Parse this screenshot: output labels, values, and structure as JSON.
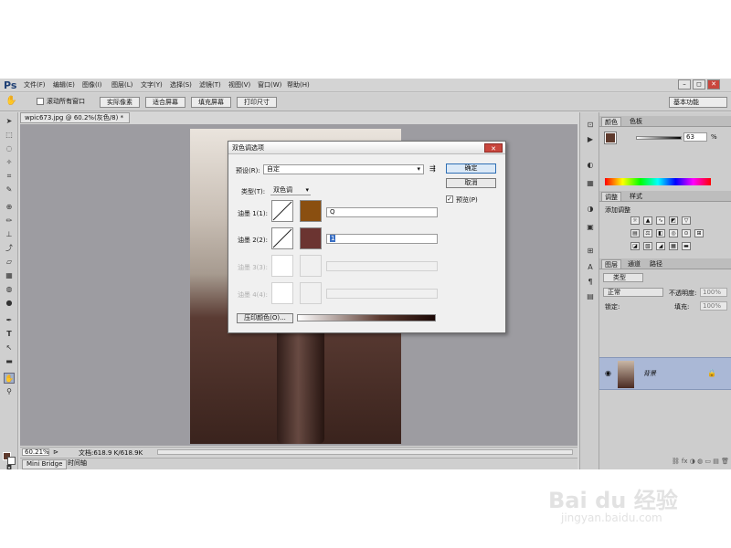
{
  "app": {
    "logo": "Ps"
  },
  "menu": [
    "文件(F)",
    "编辑(E)",
    "图像(I)",
    "图层(L)",
    "文字(Y)",
    "选择(S)",
    "滤镜(T)",
    "视图(V)",
    "窗口(W)",
    "帮助(H)"
  ],
  "window_controls": [
    "–",
    "◻",
    "✕"
  ],
  "options": {
    "scroll_all": "滚动所有窗口",
    "buttons": [
      "实际像素",
      "适合屏幕",
      "填充屏幕",
      "打印尺寸"
    ],
    "workspace": "基本功能"
  },
  "document": {
    "tab": "wpic673.jpg @ 60.2%(灰色/8) *",
    "zoom": "60.21%",
    "doc_info": "文档:618.9 K/618.9K"
  },
  "bottom_tabs": [
    "Mini Bridge",
    "时间轴"
  ],
  "panels": {
    "color_tabs": [
      "颜色",
      "色板"
    ],
    "color_value": "63",
    "color_unit": "%",
    "adjust_tabs": [
      "调整",
      "样式"
    ],
    "adjust_hint": "添加调整",
    "layers_tabs": [
      "图层",
      "通道",
      "路径"
    ],
    "kind_filter": "类型",
    "blend_mode": "正常",
    "opacity_label": "不透明度:",
    "opacity_value": "100%",
    "lock_label": "锁定:",
    "fill_label": "填充:",
    "fill_value": "100%",
    "layer_name": "背景"
  },
  "dialog": {
    "title": "双色调选项",
    "close": "✕",
    "preset_label": "预设(R):",
    "preset_value": "自定",
    "type_label": "类型(T):",
    "type_value": "双色调",
    "ok": "确定",
    "cancel": "取消",
    "preview_label": "预览(P)",
    "preview_checked": true,
    "inks": [
      {
        "label": "油墨 1(1):",
        "name": "Q",
        "color": "#8a4f10",
        "enabled": true
      },
      {
        "label": "油墨 2(2):",
        "name": "1",
        "color": "#6b3431",
        "enabled": true
      },
      {
        "label": "油墨 3(3):",
        "name": "",
        "color": "",
        "enabled": false
      },
      {
        "label": "油墨 4(4):",
        "name": "",
        "color": "",
        "enabled": false
      }
    ],
    "overprint_button": "压印颜色(O)..."
  },
  "watermark": {
    "main": "Bai du 经验",
    "sub": "jingyan.baidu.com"
  },
  "colors": {
    "accent": "#2f6fb4",
    "layer_selected": "#aab8d6"
  }
}
